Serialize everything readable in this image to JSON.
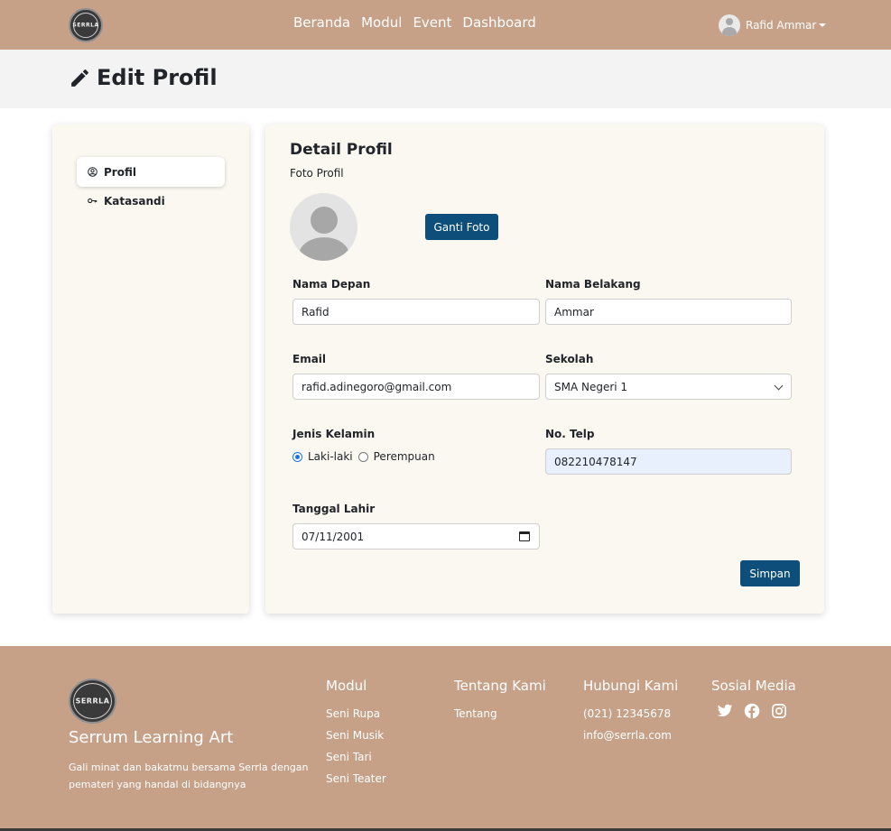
{
  "navbar": {
    "logo_text": "SERRLA",
    "links": [
      "Beranda",
      "Modul",
      "Event",
      "Dashboard"
    ],
    "user_name": "Rafid Ammar"
  },
  "header": {
    "title": "Edit Profil"
  },
  "sidebar": {
    "items": [
      {
        "label": "Profil",
        "icon": "user-circle-icon",
        "active": true
      },
      {
        "label": "Katasandi",
        "icon": "key-icon",
        "active": false
      }
    ]
  },
  "profile": {
    "title": "Detail Profil",
    "photo_label": "Foto Profil",
    "change_photo_button": "Ganti Foto",
    "first_name_label": "Nama Depan",
    "first_name_value": "Rafid",
    "last_name_label": "Nama Belakang",
    "last_name_value": "Ammar",
    "email_label": "Email",
    "email_value": "rafid.adinegoro@gmail.com",
    "school_label": "Sekolah",
    "school_value": "SMA Negeri 1",
    "gender_label": "Jenis Kelamin",
    "gender_options": [
      "Laki-laki",
      "Perempuan"
    ],
    "gender_selected": "Laki-laki",
    "phone_label": "No. Telp",
    "phone_value": "082210478147",
    "birthdate_label": "Tanggal Lahir",
    "birthdate_value": "07/11/2001",
    "save_button": "Simpan"
  },
  "footer": {
    "logo_text": "SERRLA",
    "brand_name": "Serrum Learning Art",
    "brand_desc": "Gali minat dan bakatmu bersama Serrla dengan pemateri yang handal di bidangnya",
    "columns": [
      {
        "heading": "Modul",
        "links": [
          "Seni Rupa",
          "Seni Musik",
          "Seni Tari",
          "Seni Teater"
        ]
      },
      {
        "heading": "Tentang Kami",
        "links": [
          "Tentang"
        ]
      },
      {
        "heading": "Hubungi Kami",
        "links": [
          "(021) 12345678",
          "info@serrla.com"
        ]
      }
    ],
    "social_heading": "Sosial Media",
    "social_icons": [
      "twitter-icon",
      "facebook-icon",
      "instagram-icon"
    ]
  },
  "colors": {
    "brand": "#c6a188",
    "button": "#0d4f7a",
    "card_bg": "#fbf7f1"
  }
}
